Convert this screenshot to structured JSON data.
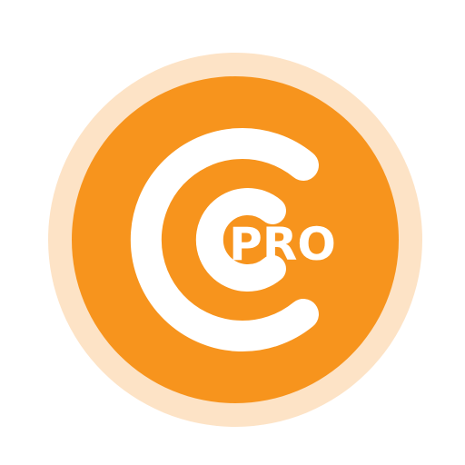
{
  "logo": {
    "badge_text": "PRO",
    "colors": {
      "halo": "#FDE3C6",
      "disc": "#F7941D",
      "mark": "#FFFFFF"
    },
    "icon": "coin-c-pro-logo-icon"
  }
}
